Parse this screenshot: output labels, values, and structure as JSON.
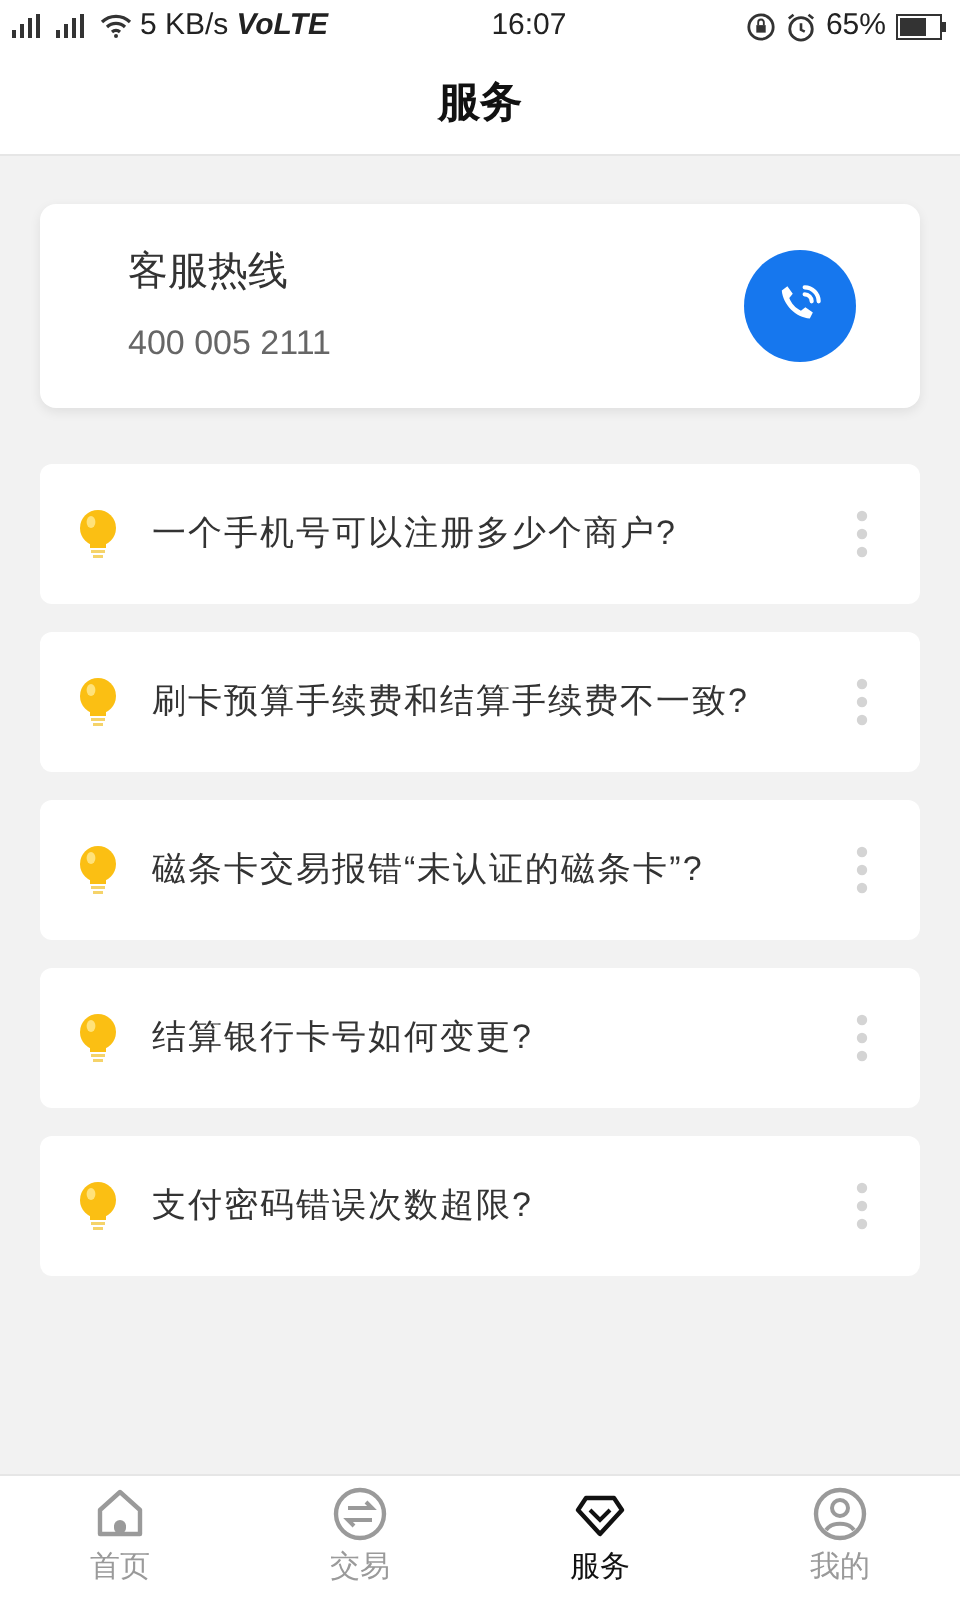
{
  "status_bar": {
    "network_speed": "5 KB/s",
    "volte": "VoLTE",
    "time": "16:07",
    "battery": "65%"
  },
  "header": {
    "title": "服务"
  },
  "hotline": {
    "title": "客服热线",
    "number": "400 005 2111"
  },
  "questions": [
    {
      "text": "一个手机号可以注册多少个商户?"
    },
    {
      "text": "刷卡预算手续费和结算手续费不一致?"
    },
    {
      "text": "磁条卡交易报错“未认证的磁条卡”?"
    },
    {
      "text": "结算银行卡号如何变更?"
    },
    {
      "text": "支付密码错误次数超限?"
    }
  ],
  "tabs": [
    {
      "label": "首页",
      "kind": "home",
      "selected": false
    },
    {
      "label": "交易",
      "kind": "trade",
      "selected": false
    },
    {
      "label": "服务",
      "kind": "service",
      "selected": true
    },
    {
      "label": "我的",
      "kind": "me",
      "selected": false
    }
  ]
}
